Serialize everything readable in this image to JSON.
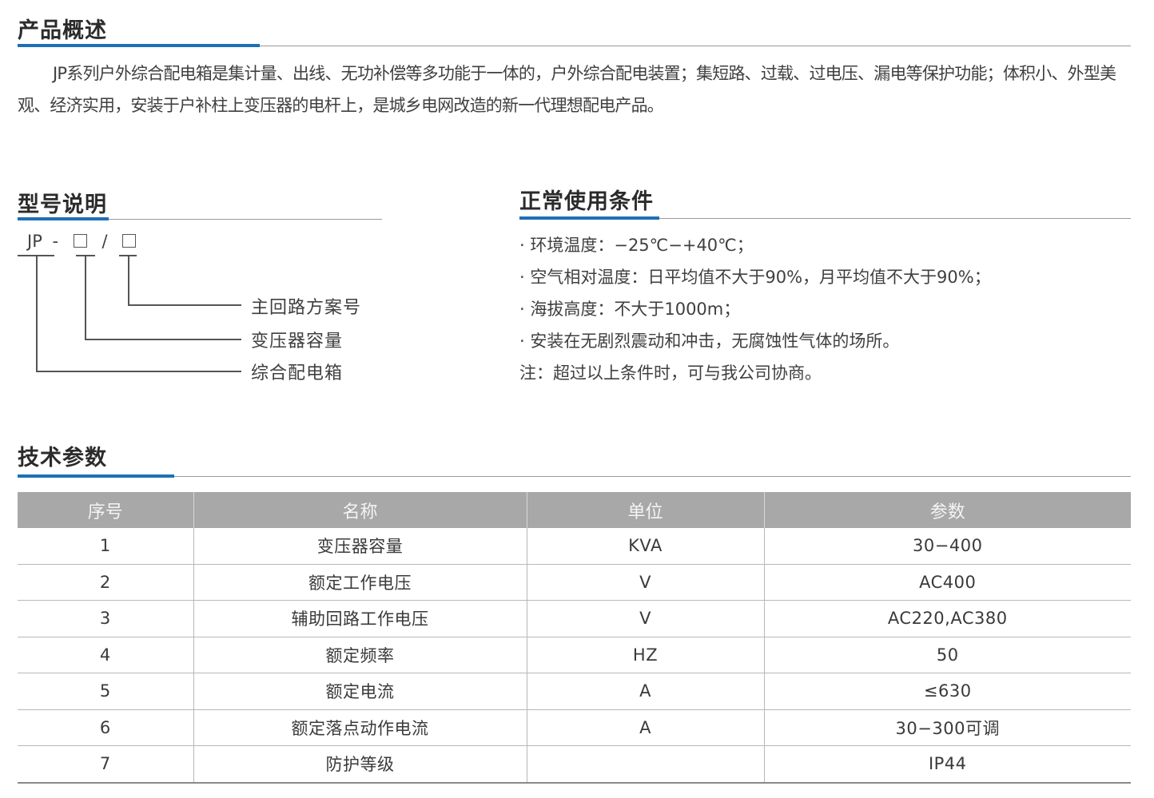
{
  "overview": {
    "title": "产品概述",
    "text": "JP系列户外综合配电箱是集计量、出线、无功补偿等多功能于一体的，户外综合配电装置；集短路、过载、过电压、漏电等保护功能；体积小、外型美观、经济实用，安装于户补柱上变压器的电杆上，是城乡电网改造的新一代理想配电产品。"
  },
  "model": {
    "title": "型号说明",
    "prefix": "JP",
    "dash": "-",
    "slash": "/",
    "labels": [
      "主回路方案号",
      "变压器容量",
      "综合配电箱"
    ]
  },
  "conditions": {
    "title": "正常使用条件",
    "items": [
      "· 环境温度：−25℃−+40℃；",
      "· 空气相对温度：日平均值不大于90%，月平均值不大于90%；",
      "· 海拔高度：不大于1000m；",
      "· 安装在无剧烈震动和冲击，无腐蚀性气体的场所。"
    ],
    "note": "注：超过以上条件时，可与我公司协商。"
  },
  "params": {
    "title": "技术参数",
    "headers": [
      "序号",
      "名称",
      "单位",
      "参数"
    ],
    "rows": [
      [
        "1",
        "变压器容量",
        "KVA",
        "30−400"
      ],
      [
        "2",
        "额定工作电压",
        "V",
        "AC400"
      ],
      [
        "3",
        "辅助回路工作电压",
        "V",
        "AC220,AC380"
      ],
      [
        "4",
        "额定频率",
        "HZ",
        "50"
      ],
      [
        "5",
        "额定电流",
        "A",
        "≤630"
      ],
      [
        "6",
        "额定落点动作电流",
        "A",
        "30−300可调"
      ],
      [
        "7",
        "防护等级",
        "",
        "IP44"
      ]
    ]
  },
  "colors": {
    "accent": "#1f6fb5",
    "table_header_bg": "#a8a8a8",
    "text": "#3a3a3a"
  }
}
